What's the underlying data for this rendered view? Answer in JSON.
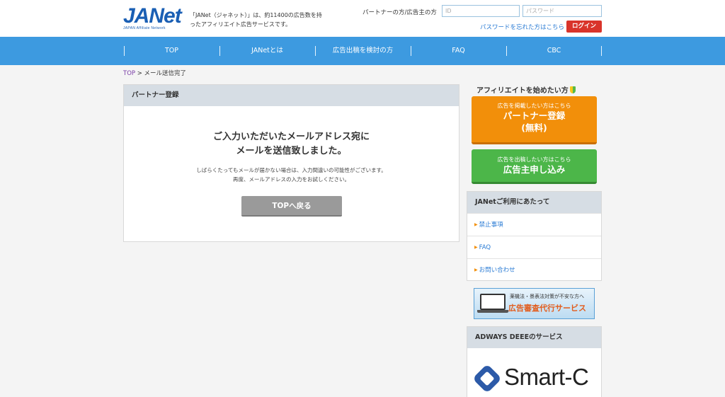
{
  "header": {
    "logo_text": "JANet",
    "logo_sub": "JAPAN Affiliate Network",
    "intro_line1": "「JANet（ジャネット）」は、約11400の広告数を持",
    "intro_line2": "ったアフィリエイト広告サービスです。",
    "login_label": "パートナーの方/広告主の方",
    "id_placeholder": "ID",
    "password_placeholder": "パスワード",
    "forgot_password": "パスワードを忘れた方はこちら",
    "login_button": "ログイン"
  },
  "nav": {
    "items": [
      {
        "label": "TOP"
      },
      {
        "label": "JANetとは"
      },
      {
        "label": "広告出稿を検討の方"
      },
      {
        "label": "FAQ"
      },
      {
        "label": "CBC"
      }
    ]
  },
  "breadcrumb": {
    "home": "TOP",
    "separator": ">",
    "current": "メール送信完了"
  },
  "main": {
    "panel_title": "パートナー登録",
    "message_line1": "ご入力いただいたメールアドレス宛に",
    "message_line2": "メールを送信致しました。",
    "note_line1": "しばらくたってもメールが届かない場合は、入力間違いの可能性がございます。",
    "note_line2": "再度、メールアドレスの入力をお試しください。",
    "back_button": "TOPへ戻る"
  },
  "sidebar": {
    "affiliate_title": "アフィリエイトを始めたい方",
    "partner_cta": {
      "small": "広告を掲載したい方はこちら",
      "line1": "パートナー登録",
      "line2": "(無料)"
    },
    "advertiser_cta": {
      "small": "広告を出稿したい方はこちら",
      "line1": "広告主申し込み"
    },
    "usage_title": "JANetご利用にあたって",
    "usage_links": [
      {
        "label": "禁止事項"
      },
      {
        "label": "FAQ"
      },
      {
        "label": "お問い合わせ"
      }
    ],
    "banner": {
      "line1": "薬機法・景表法対策が不安な方へ",
      "line2": "広告審査代行サービス"
    },
    "adways_title": "ADWAYS DEEEのサービス",
    "smartc_text": "Smart-C"
  },
  "colors": {
    "nav_bg": "#3d9ae0",
    "login_red": "#d9342b",
    "cta_orange": "#f28f0a",
    "cta_green": "#4cb649",
    "link_blue": "#2a7bd4"
  }
}
